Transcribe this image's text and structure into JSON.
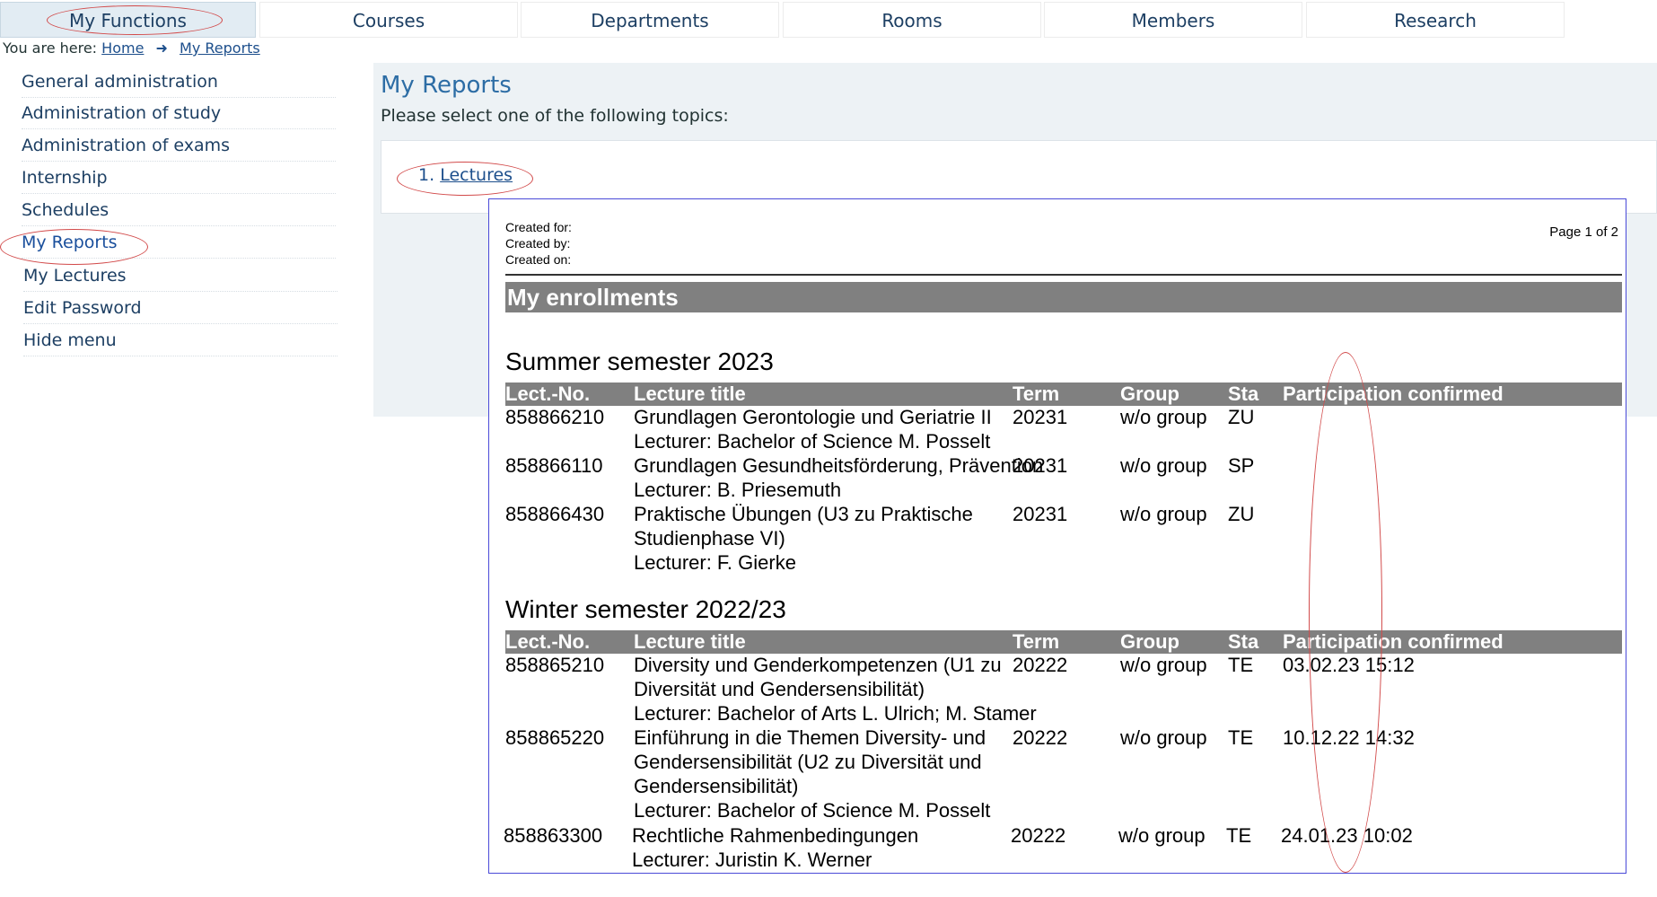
{
  "top_nav": {
    "tabs": [
      "My Functions",
      "Courses",
      "Departments",
      "Rooms",
      "Members",
      "Research"
    ]
  },
  "breadcrumb": {
    "prefix": "You are here:",
    "home": "Home",
    "current": "My Reports"
  },
  "sidebar": {
    "items": [
      "General administration",
      "Administration of study",
      "Administration of exams",
      "Internship",
      "Schedules",
      "My Reports",
      "My Lectures",
      "Edit Password",
      "Hide menu"
    ]
  },
  "main": {
    "title": "My Reports",
    "subtitle": "Please select one of the following topics:",
    "topic_number": "1.",
    "topic_link": "Lectures"
  },
  "report": {
    "meta": [
      "Created for:",
      "Created by:",
      "Created on:"
    ],
    "page_info": "Page 1 of 2",
    "heading": "My enrollments",
    "columns": [
      "Lect.-No.",
      "Lecture title",
      "Term",
      "Group",
      "Sta",
      "Participation confirmed"
    ],
    "summer": {
      "title": "Summer semester 2023",
      "rows": [
        {
          "no": "858866210",
          "title": "Grundlagen Gerontologie und Geriatrie II",
          "lecturer": "Lecturer: Bachelor of Science M. Posselt",
          "term": "20231",
          "group": "w/o group",
          "status": "ZU",
          "confirmed": ""
        },
        {
          "no": "858866110",
          "title": "Grundlagen Gesundheitsförderung, Prävention",
          "lecturer": "Lecturer: B. Priesemuth",
          "term": "20231",
          "group": "w/o group",
          "status": "SP",
          "confirmed": ""
        },
        {
          "no": "858866430",
          "title": "Praktische Übungen (U3 zu Praktische Studienphase VI)",
          "lecturer": "Lecturer: F. Gierke",
          "term": "20231",
          "group": "w/o group",
          "status": "ZU",
          "confirmed": ""
        }
      ]
    },
    "winter": {
      "title": "Winter semester 2022/23",
      "rows": [
        {
          "no": "858865210",
          "title": "Diversity und Genderkompetenzen (U1 zu Diversität und Gendersensibilität)",
          "lecturer": "Lecturer: Bachelor of Arts L. Ulrich; M. Stamer",
          "term": "20222",
          "group": "w/o group",
          "status": "TE",
          "confirmed": "03.02.23 15:12"
        },
        {
          "no": "858865220",
          "title": "Einführung in die Themen Diversity- und Gendersensibilität (U2 zu Diversität und Gendersensibilität)",
          "lecturer": "Lecturer: Bachelor of Science M. Posselt",
          "term": "20222",
          "group": "w/o group",
          "status": "TE",
          "confirmed": "10.12.22 14:32"
        },
        {
          "no": "858863300",
          "title": "Rechtliche Rahmenbedingungen",
          "lecturer": "Lecturer: Juristin K. Werner",
          "term": "20222",
          "group": "w/o group",
          "status": "TE",
          "confirmed": "24.01.23 10:02"
        }
      ]
    }
  },
  "colors": {
    "nav_text": "#1d3f63",
    "link": "#1d4f8c",
    "title_blue": "#2d6da5",
    "annotation_red": "#d24a4a",
    "report_border": "#4a4ad8",
    "header_gray": "#808080"
  }
}
